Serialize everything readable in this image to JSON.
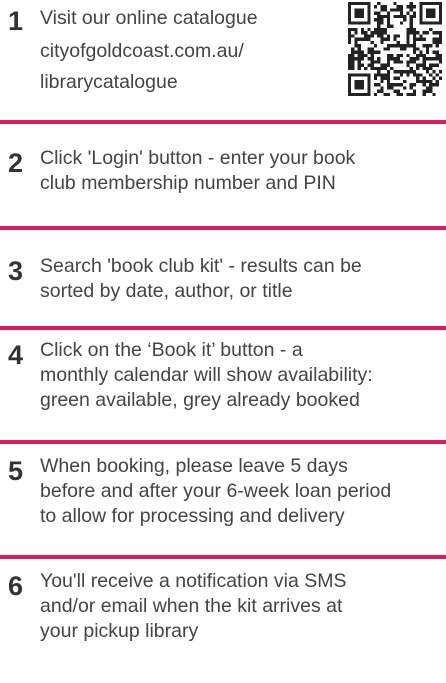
{
  "accent_color": "#e01a5f",
  "steps": [
    {
      "number": "1",
      "lines": [
        "Visit our online catalogue",
        "cityofgoldcoast.com.au/",
        "librarycatalogue"
      ]
    },
    {
      "number": "2",
      "lines": [
        "Click 'Login' button - enter your book",
        "club membership number and PIN"
      ]
    },
    {
      "number": "3",
      "lines": [
        "Search 'book club kit' - results can be",
        "sorted by date, author, or title"
      ]
    },
    {
      "number": "4",
      "lines": [
        "Click on the ‘Book it’ button - a",
        "monthly calendar will show availability:",
        "green available, grey already booked"
      ]
    },
    {
      "number": "5",
      "lines": [
        "When booking, please leave 5 days",
        "before and after your 6-week loan period",
        "to allow for processing and delivery"
      ]
    },
    {
      "number": "6",
      "lines": [
        "You'll receive a notification via SMS",
        "and/or email when the kit arrives at",
        "your pickup library"
      ]
    }
  ],
  "qr_code": {
    "icon": "qr-code-icon"
  }
}
